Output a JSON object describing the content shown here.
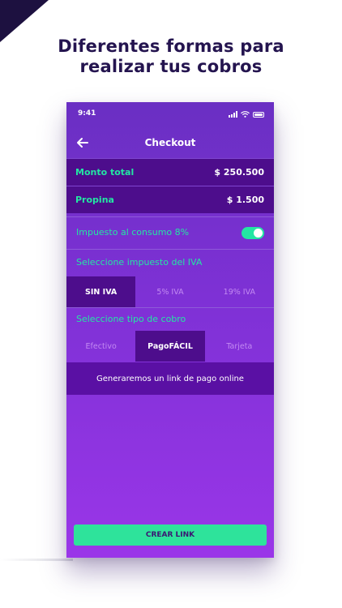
{
  "headline": {
    "line1": "Diferentes formas para",
    "line2": "realizar tus cobros"
  },
  "status_bar": {
    "time": "9:41"
  },
  "nav": {
    "title": "Checkout",
    "back_icon": "arrow-left-icon"
  },
  "summary": {
    "total_label": "Monto total",
    "total_value": "$ 250.500",
    "tip_label": "Propina",
    "tip_value": "$ 1.500"
  },
  "consumption_tax": {
    "label": "Impuesto al consumo 8%",
    "enabled": true
  },
  "iva": {
    "label": "Seleccione impuesto del IVA",
    "options": [
      "SIN IVA",
      "5% IVA",
      "19% IVA"
    ],
    "selected": "SIN IVA"
  },
  "payment_type": {
    "label": "Seleccione tipo de cobro",
    "options": [
      "Efectivo",
      "PagoFÁCIL",
      "Tarjeta"
    ],
    "selected": "PagoFÁCIL"
  },
  "info_message": "Generaremos un link de pago online",
  "cta_label": "CREAR LINK",
  "colors": {
    "accent_green": "#23e6a3",
    "dark_purple": "#4d0d8c",
    "headline_navy": "#24144f"
  }
}
